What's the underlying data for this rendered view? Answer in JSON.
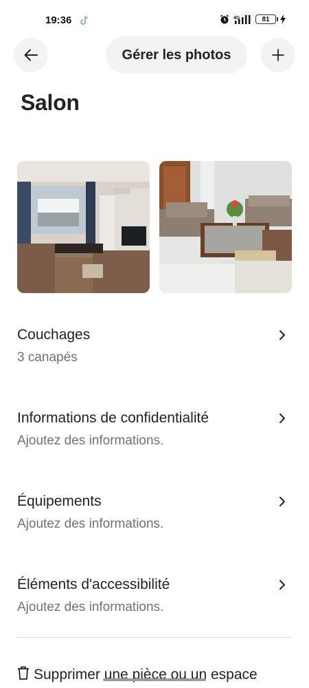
{
  "status_bar": {
    "time": "19:36",
    "battery": "81",
    "icons": [
      "tiktok-icon",
      "alarm-icon",
      "signal-4g-icon",
      "battery-icon",
      "charging-icon"
    ]
  },
  "header": {
    "back_icon": "arrow-left-icon",
    "manage_photos_label": "Gérer les photos",
    "add_icon": "plus-icon"
  },
  "room": {
    "title": "Salon",
    "photos": [
      "living-room-photo-1",
      "living-room-photo-2"
    ]
  },
  "rows": [
    {
      "title": "Couchages",
      "subtitle": "3 canapés"
    },
    {
      "title": "Informations de confidentialité",
      "subtitle": "Ajoutez des informations."
    },
    {
      "title": "Équipements",
      "subtitle": "Ajoutez des informations."
    },
    {
      "title": "Éléments d'accessibilité",
      "subtitle": "Ajoutez des informations."
    }
  ],
  "delete_action": {
    "label": "Supprimer une pièce ou un espace",
    "icon": "trash-icon"
  },
  "colors": {
    "text_primary": "#222222",
    "text_secondary": "#717171",
    "button_bg": "#f3f3f3",
    "divider": "#dddddd"
  }
}
